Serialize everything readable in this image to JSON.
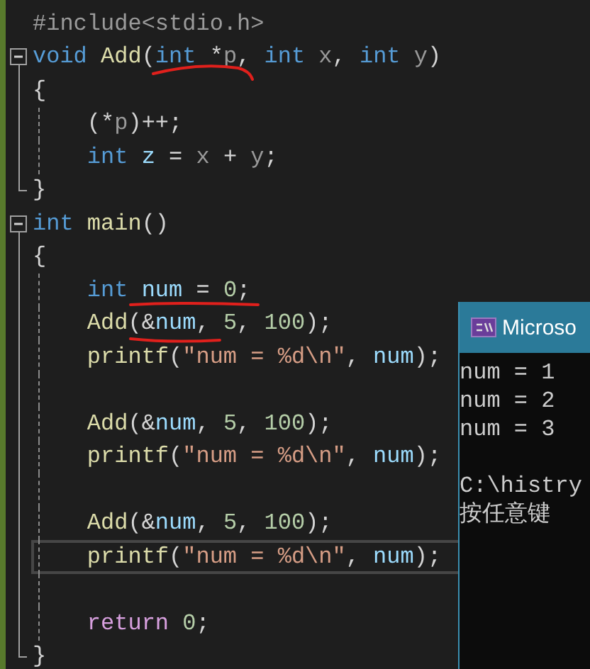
{
  "editor": {
    "lines": [
      {
        "tokens": [
          {
            "text": "#include<stdio.h>",
            "kind": "preproc"
          }
        ]
      },
      {
        "tokens": [
          {
            "text": "void",
            "kind": "keyword"
          },
          {
            "text": " Add",
            "kind": "function"
          },
          {
            "text": "(",
            "kind": "plain"
          },
          {
            "text": "int",
            "kind": "keyword"
          },
          {
            "text": " *",
            "kind": "plain"
          },
          {
            "text": "p",
            "kind": "param"
          },
          {
            "text": ", ",
            "kind": "plain"
          },
          {
            "text": "int",
            "kind": "keyword"
          },
          {
            "text": " x",
            "kind": "param"
          },
          {
            "text": ", ",
            "kind": "plain"
          },
          {
            "text": "int",
            "kind": "keyword"
          },
          {
            "text": " y",
            "kind": "param"
          },
          {
            "text": ")",
            "kind": "plain"
          }
        ],
        "expanded": true,
        "children": [
          {
            "tokens": [
              {
                "text": "{",
                "kind": "plain"
              }
            ]
          },
          {
            "tokens": [
              {
                "text": "    (*",
                "kind": "plain"
              },
              {
                "text": "p",
                "kind": "param"
              },
              {
                "text": ")++;",
                "kind": "plain"
              }
            ]
          },
          {
            "tokens": [
              {
                "text": "    int",
                "kind": "keyword"
              },
              {
                "text": " z",
                "kind": "variable"
              },
              {
                "text": " = ",
                "kind": "plain"
              },
              {
                "text": "x",
                "kind": "param"
              },
              {
                "text": " + ",
                "kind": "plain"
              },
              {
                "text": "y",
                "kind": "param"
              },
              {
                "text": ";",
                "kind": "plain"
              }
            ]
          },
          {
            "tokens": [
              {
                "text": "}",
                "kind": "plain"
              }
            ]
          }
        ]
      },
      {
        "tokens": [
          {
            "text": "int",
            "kind": "keyword"
          },
          {
            "text": " main",
            "kind": "function"
          },
          {
            "text": "()",
            "kind": "plain"
          }
        ],
        "expanded": true,
        "children": [
          {
            "tokens": [
              {
                "text": "{",
                "kind": "plain"
              }
            ]
          },
          {
            "tokens": [
              {
                "text": "    int",
                "kind": "keyword"
              },
              {
                "text": " num",
                "kind": "variable"
              },
              {
                "text": " = ",
                "kind": "plain"
              },
              {
                "text": "0",
                "kind": "number"
              },
              {
                "text": ";",
                "kind": "plain"
              }
            ]
          },
          {
            "tokens": [
              {
                "text": "    Add",
                "kind": "function"
              },
              {
                "text": "(&",
                "kind": "plain"
              },
              {
                "text": "num",
                "kind": "variable"
              },
              {
                "text": ", ",
                "kind": "plain"
              },
              {
                "text": "5",
                "kind": "number"
              },
              {
                "text": ", ",
                "kind": "plain"
              },
              {
                "text": "100",
                "kind": "number"
              },
              {
                "text": ");",
                "kind": "plain"
              }
            ]
          },
          {
            "tokens": [
              {
                "text": "    printf",
                "kind": "function"
              },
              {
                "text": "(",
                "kind": "plain"
              },
              {
                "text": "\"num = %d\\n\"",
                "kind": "string"
              },
              {
                "text": ", ",
                "kind": "plain"
              },
              {
                "text": "num",
                "kind": "variable"
              },
              {
                "text": ");",
                "kind": "plain"
              }
            ]
          },
          {
            "kind": "blank"
          },
          {
            "tokens": [
              {
                "text": "    Add",
                "kind": "function"
              },
              {
                "text": "(&",
                "kind": "plain"
              },
              {
                "text": "num",
                "kind": "variable"
              },
              {
                "text": ", ",
                "kind": "plain"
              },
              {
                "text": "5",
                "kind": "number"
              },
              {
                "text": ", ",
                "kind": "plain"
              },
              {
                "text": "100",
                "kind": "number"
              },
              {
                "text": ");",
                "kind": "plain"
              }
            ]
          },
          {
            "tokens": [
              {
                "text": "    printf",
                "kind": "function"
              },
              {
                "text": "(",
                "kind": "plain"
              },
              {
                "text": "\"num = %d\\n\"",
                "kind": "string"
              },
              {
                "text": ", ",
                "kind": "plain"
              },
              {
                "text": "num",
                "kind": "variable"
              },
              {
                "text": ");",
                "kind": "plain"
              }
            ]
          },
          {
            "kind": "blank"
          },
          {
            "tokens": [
              {
                "text": "    Add",
                "kind": "function"
              },
              {
                "text": "(&",
                "kind": "plain"
              },
              {
                "text": "num",
                "kind": "variable"
              },
              {
                "text": ", ",
                "kind": "plain"
              },
              {
                "text": "5",
                "kind": "number"
              },
              {
                "text": ", ",
                "kind": "plain"
              },
              {
                "text": "100",
                "kind": "number"
              },
              {
                "text": ");",
                "kind": "plain"
              }
            ]
          },
          {
            "tokens": [
              {
                "text": "    printf",
                "kind": "function"
              },
              {
                "text": "(",
                "kind": "plain"
              },
              {
                "text": "\"num = %d\\n\"",
                "kind": "string"
              },
              {
                "text": ", ",
                "kind": "plain"
              },
              {
                "text": "num",
                "kind": "variable"
              },
              {
                "text": ");",
                "kind": "plain"
              }
            ],
            "current": true
          },
          {
            "kind": "blank"
          },
          {
            "tokens": [
              {
                "text": "    return",
                "kind": "control"
              },
              {
                "text": " 0",
                "kind": "number"
              },
              {
                "text": ";",
                "kind": "plain"
              }
            ]
          },
          {
            "tokens": [
              {
                "text": "}",
                "kind": "plain"
              }
            ]
          }
        ]
      }
    ]
  },
  "console": {
    "title": "Microso",
    "lines": [
      {
        "text": "num = 1"
      },
      {
        "text": "num = 2"
      },
      {
        "text": "num = 3"
      },
      {
        "kind": "blank"
      },
      {
        "text": "C:\\histry"
      },
      {
        "text": "按任意键"
      }
    ]
  }
}
